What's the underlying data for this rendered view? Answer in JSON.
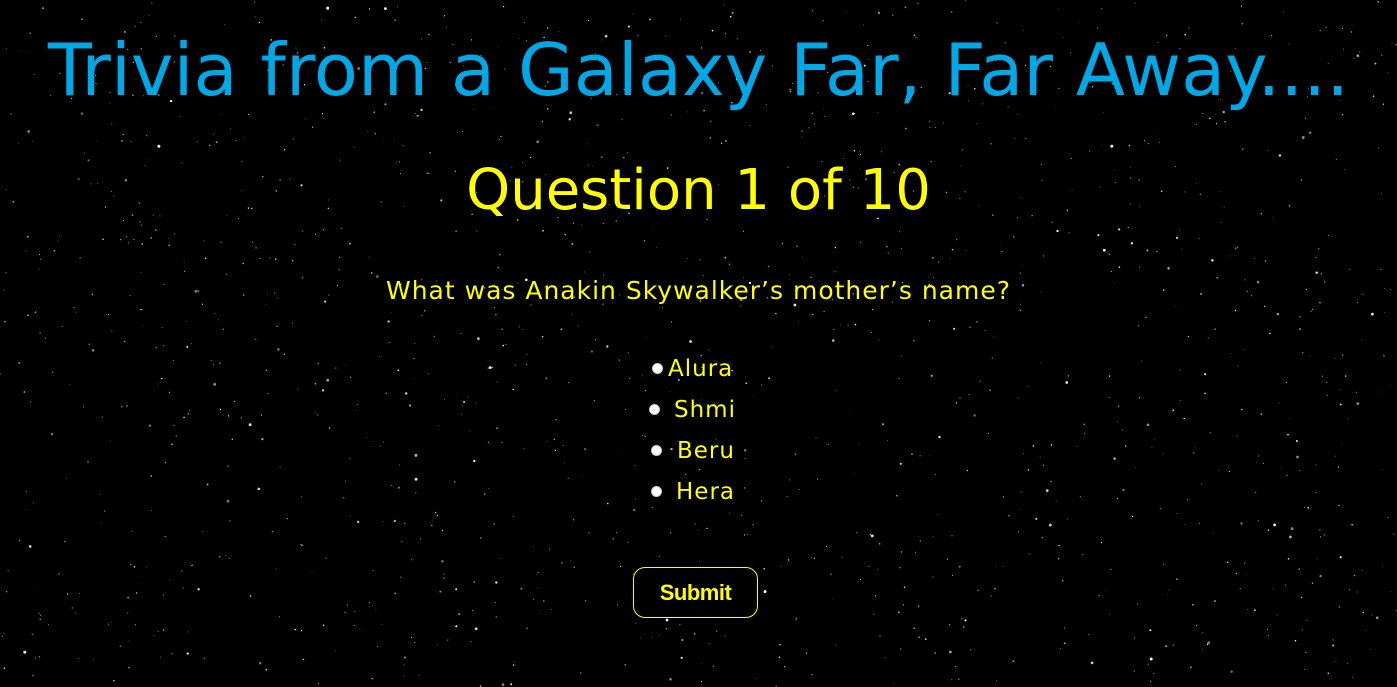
{
  "page": {
    "title": "Trivia from a Galaxy Far, Far Away....",
    "question_counter": "Question 1 of 10",
    "question_text": "What was Anakin Skywalker’s mother’s name?",
    "answers": [
      {
        "label": "Alura",
        "selected": false
      },
      {
        "label": "Shmi",
        "selected": false
      },
      {
        "label": "Beru",
        "selected": false
      },
      {
        "label": "Hera",
        "selected": false
      }
    ],
    "submit_label": "Submit"
  },
  "colors": {
    "background": "#000000",
    "title": "#00A8E8",
    "accent": "#FFFF00",
    "stars": "#FFFFFF"
  }
}
